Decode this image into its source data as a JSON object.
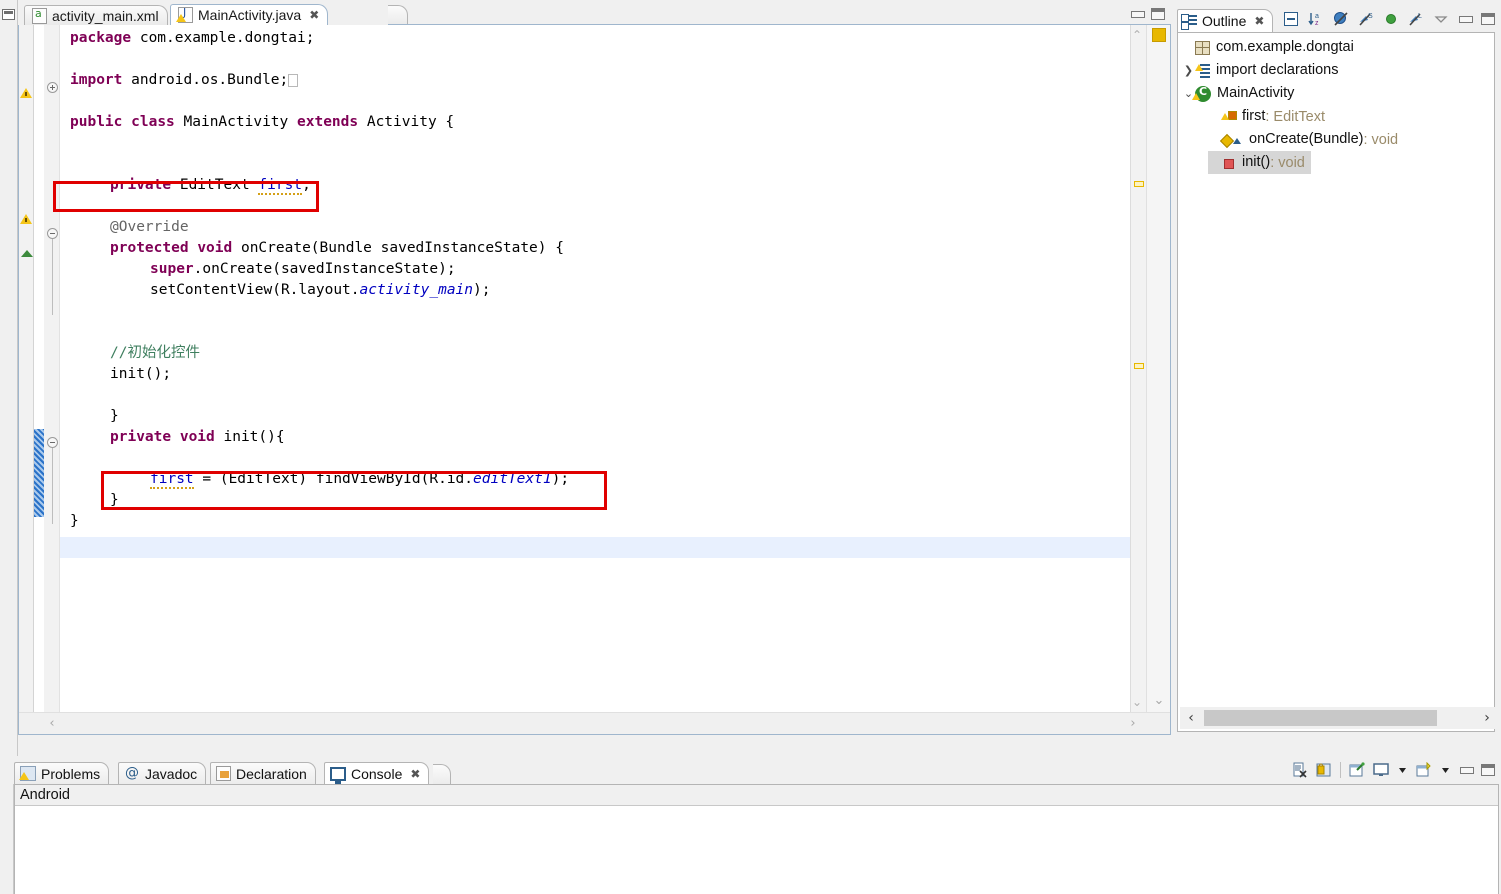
{
  "editor": {
    "tabs": [
      {
        "label": "activity_main.xml",
        "icon": "xml-file-icon",
        "active": false,
        "closable": false
      },
      {
        "label": "MainActivity.java",
        "icon": "java-file-icon",
        "active": true,
        "closable": true,
        "close": "✖"
      }
    ],
    "window_buttons": {
      "minimize": "minimize-icon",
      "maximize": "maximize-icon"
    },
    "code_lines": [
      {
        "indent": 0,
        "html": "<span class=\"kw\">package</span> com.example.dongtai;"
      },
      {
        "indent": 0,
        "html": ""
      },
      {
        "indent": 0,
        "html": "<span class=\"kw\">import</span> android.os.Bundle;<span class=\"hidden-marker\"></span>"
      },
      {
        "indent": 0,
        "html": ""
      },
      {
        "indent": 0,
        "html": "<span class=\"kw\">public</span> <span class=\"kw\">class</span> MainActivity <span class=\"kw\">extends</span> Activity {"
      },
      {
        "indent": 0,
        "html": ""
      },
      {
        "indent": 0,
        "html": ""
      },
      {
        "indent": 1,
        "html": "<span class=\"kw\">private</span> EditText <span class=\"fld squig\">first</span>;"
      },
      {
        "indent": 0,
        "html": ""
      },
      {
        "indent": 1,
        "html": "<span class=\"ann\">@Override</span>"
      },
      {
        "indent": 1,
        "html": "<span class=\"kw\">protected</span> <span class=\"kw\">void</span> onCreate(Bundle savedInstanceState) {"
      },
      {
        "indent": 2,
        "html": "<span class=\"kw\">super</span>.onCreate(savedInstanceState);"
      },
      {
        "indent": 2,
        "html": "setContentView(R.layout.<span class=\"sfld\">activity_main</span>);"
      },
      {
        "indent": 0,
        "html": ""
      },
      {
        "indent": 0,
        "html": ""
      },
      {
        "indent": 1,
        "html": "<span class=\"cmt\">//初始化控件</span>"
      },
      {
        "indent": 1,
        "html": "init();"
      },
      {
        "indent": 0,
        "html": ""
      },
      {
        "indent": 1,
        "html": "}"
      },
      {
        "indent": 1,
        "html": "<span class=\"kw\">private</span> <span class=\"kw\">void</span> init(){"
      },
      {
        "indent": 0,
        "html": ""
      },
      {
        "indent": 2,
        "html": "<span class=\"fld squig\">first</span> = (EditText) findViewById(R.id.<span class=\"sfld\">editText1</span>);"
      },
      {
        "indent": 1,
        "html": "}"
      },
      {
        "indent": 0,
        "html": "}"
      }
    ],
    "plain_code": [
      "package com.example.dongtai;",
      "",
      "import android.os.Bundle;",
      "",
      "public class MainActivity extends Activity {",
      "",
      "",
      "    private EditText first;",
      "",
      "    @Override",
      "    protected void onCreate(Bundle savedInstanceState) {",
      "        super.onCreate(savedInstanceState);",
      "        setContentView(R.layout.activity_main);",
      "",
      "",
      "    //初始化控件",
      "    init();",
      "",
      "    }",
      "    private void init(){",
      "",
      "        first = (EditText) findViewById(R.id.editText1);",
      "    }",
      "}"
    ],
    "annotations": [
      {
        "name": "highlight-box-field-declaration",
        "text": "private EditText first;",
        "color": "#e00000"
      },
      {
        "name": "highlight-box-findviewbyid",
        "text": "first = (EditText) findViewById(R.id.editText1);",
        "color": "#e00000"
      }
    ],
    "scroll": {
      "up_arrow": "⌃",
      "down_arrow": "⌄",
      "left_arrow": "‹",
      "right_arrow": "›"
    }
  },
  "outline": {
    "title": "Outline",
    "close": "✖",
    "toolbar": [
      "collapse-all-icon",
      "sort-icon",
      "hide-fields-icon",
      "hide-static-icon",
      "hide-public-icon",
      "hide-local-types-icon",
      "view-menu-icon",
      "minimize-icon",
      "maximize-icon"
    ],
    "items": [
      {
        "label": "com.example.dongtai",
        "icon": "package-icon",
        "arrow": "",
        "indent": 0,
        "selected": false,
        "type": ""
      },
      {
        "label": "import declarations",
        "icon": "import-declarations-icon",
        "arrow": "❯",
        "indent": 0,
        "selected": false,
        "type": ""
      },
      {
        "label": "MainActivity",
        "icon": "class-icon",
        "arrow": "⌄",
        "indent": 0,
        "selected": false,
        "type": ""
      },
      {
        "label": "first",
        "icon": "field-icon",
        "arrow": "",
        "indent": 1,
        "selected": false,
        "type": " : EditText"
      },
      {
        "label": "onCreate(Bundle)",
        "icon": "method-icon",
        "arrow": "",
        "indent": 1,
        "selected": false,
        "type": " : void"
      },
      {
        "label": "init()",
        "icon": "private-method-icon",
        "arrow": "",
        "indent": 1,
        "selected": true,
        "type": " : void"
      }
    ],
    "scroll": {
      "left_arrow": "‹",
      "right_arrow": "›"
    }
  },
  "bottom": {
    "tabs": [
      {
        "label": "Problems",
        "icon": "problems-icon",
        "active": false,
        "closable": false
      },
      {
        "label": "Javadoc",
        "icon": "javadoc-icon",
        "active": false,
        "closable": false
      },
      {
        "label": "Declaration",
        "icon": "declaration-icon",
        "active": false,
        "closable": false
      },
      {
        "label": "Console",
        "icon": "console-icon",
        "active": true,
        "closable": true,
        "close": "✖"
      }
    ],
    "toolbar": [
      "clear-console-icon",
      "lock-scroll-icon",
      "pin-console-icon",
      "display-console-icon",
      "display-menu-arrow-icon",
      "open-console-icon",
      "open-console-menu-arrow-icon",
      "minimize-icon",
      "maximize-icon"
    ],
    "console_title": "Android",
    "console_content": ""
  }
}
